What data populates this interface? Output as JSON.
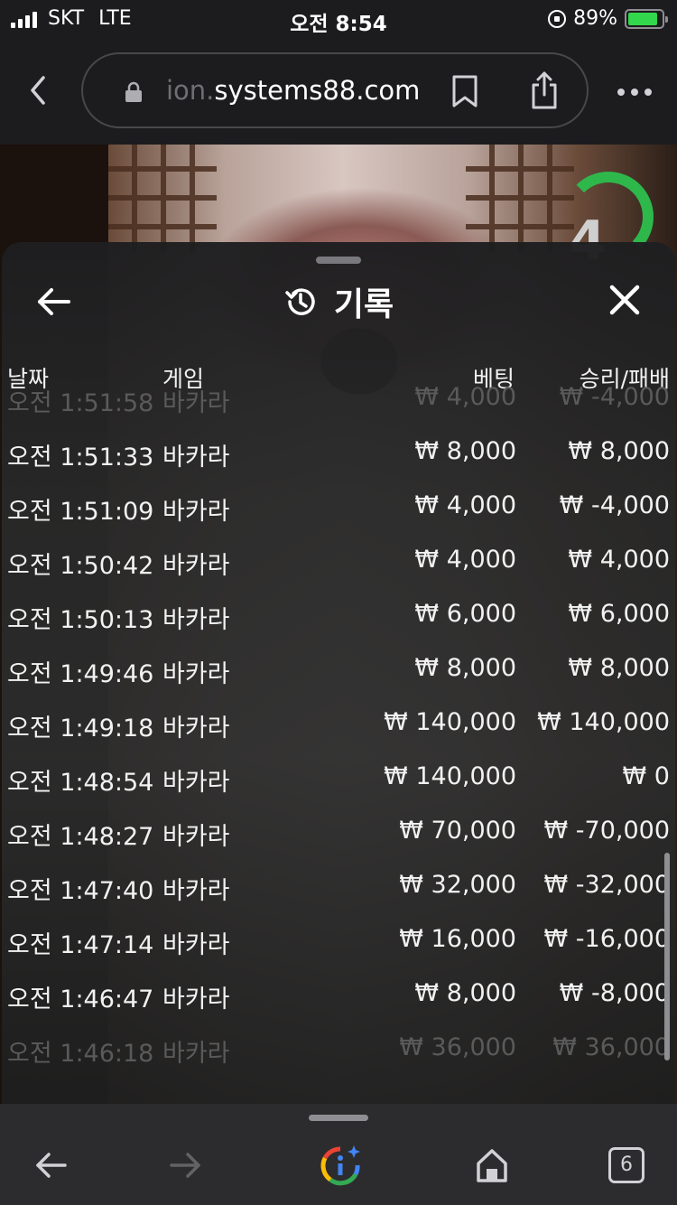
{
  "status_bar": {
    "carrier": "SKT",
    "network": "LTE",
    "time": "오전 8:54",
    "battery": "89%",
    "battery_level": 0.89
  },
  "browser": {
    "url_prefix": "ion.",
    "url_domain": "systems88.com"
  },
  "background": {
    "timer_digit": "4"
  },
  "panel": {
    "title": "기록",
    "columns": {
      "date": "날짜",
      "game": "게임",
      "bet": "베팅",
      "result": "승리/패배"
    },
    "rows": [
      {
        "time": "오전 1:51:58",
        "game": "바카라",
        "bet": "₩ 4,000",
        "result": "₩ -4,000"
      },
      {
        "time": "오전 1:51:33",
        "game": "바카라",
        "bet": "₩ 8,000",
        "result": "₩ 8,000"
      },
      {
        "time": "오전 1:51:09",
        "game": "바카라",
        "bet": "₩ 4,000",
        "result": "₩ -4,000"
      },
      {
        "time": "오전 1:50:42",
        "game": "바카라",
        "bet": "₩ 4,000",
        "result": "₩ 4,000"
      },
      {
        "time": "오전 1:50:13",
        "game": "바카라",
        "bet": "₩ 6,000",
        "result": "₩ 6,000"
      },
      {
        "time": "오전 1:49:46",
        "game": "바카라",
        "bet": "₩ 8,000",
        "result": "₩ 8,000"
      },
      {
        "time": "오전 1:49:18",
        "game": "바카라",
        "bet": "₩ 140,000",
        "result": "₩ 140,000"
      },
      {
        "time": "오전 1:48:54",
        "game": "바카라",
        "bet": "₩ 140,000",
        "result": "₩ 0"
      },
      {
        "time": "오전 1:48:27",
        "game": "바카라",
        "bet": "₩ 70,000",
        "result": "₩ -70,000"
      },
      {
        "time": "오전 1:47:40",
        "game": "바카라",
        "bet": "₩ 32,000",
        "result": "₩ -32,000"
      },
      {
        "time": "오전 1:47:14",
        "game": "바카라",
        "bet": "₩ 16,000",
        "result": "₩ -16,000"
      },
      {
        "time": "오전 1:46:47",
        "game": "바카라",
        "bet": "₩ 8,000",
        "result": "₩ -8,000"
      },
      {
        "time": "오전 1:46:18",
        "game": "바카라",
        "bet": "₩ 36,000",
        "result": "₩ 36,000"
      }
    ]
  },
  "toolbar": {
    "tab_count": "6"
  }
}
